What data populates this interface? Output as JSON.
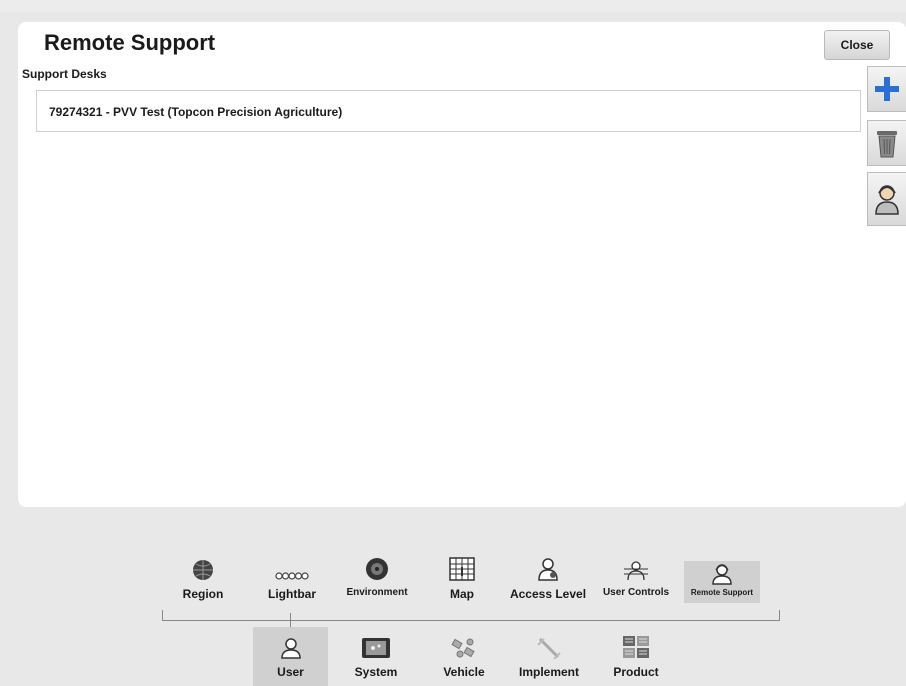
{
  "header": {
    "title": "Remote Support",
    "close_label": "Close"
  },
  "support_desks": {
    "label": "Support Desks",
    "items": [
      {
        "label": "79274321 - PVV Test (Topcon Precision Agriculture)"
      }
    ]
  },
  "side_actions": [
    {
      "icon": "add-icon"
    },
    {
      "icon": "trash-icon"
    },
    {
      "icon": "support-person-icon"
    }
  ],
  "nav": {
    "top_row": [
      {
        "label": "Region",
        "icon": "globe-icon"
      },
      {
        "label": "Lightbar",
        "icon": "lightbar-icon"
      },
      {
        "label": "Environment",
        "icon": "speaker-icon"
      },
      {
        "label": "Map",
        "icon": "map-grid-icon"
      },
      {
        "label": "Access Level",
        "icon": "access-person-icon"
      },
      {
        "label": "User Controls",
        "icon": "user-controls-icon"
      },
      {
        "label": "Remote Support",
        "icon": "remote-support-icon",
        "selected": true
      }
    ],
    "bottom_row": [
      {
        "label": "User",
        "icon": "user-icon",
        "selected": true
      },
      {
        "label": "System",
        "icon": "system-icon"
      },
      {
        "label": "Vehicle",
        "icon": "vehicle-icon"
      },
      {
        "label": "Implement",
        "icon": "implement-icon"
      },
      {
        "label": "Product",
        "icon": "product-icon"
      }
    ]
  },
  "colors": {
    "accent_plus": "#2a6fd6",
    "selected_tab": "#d0d0d0",
    "panel": "#ffffff"
  }
}
